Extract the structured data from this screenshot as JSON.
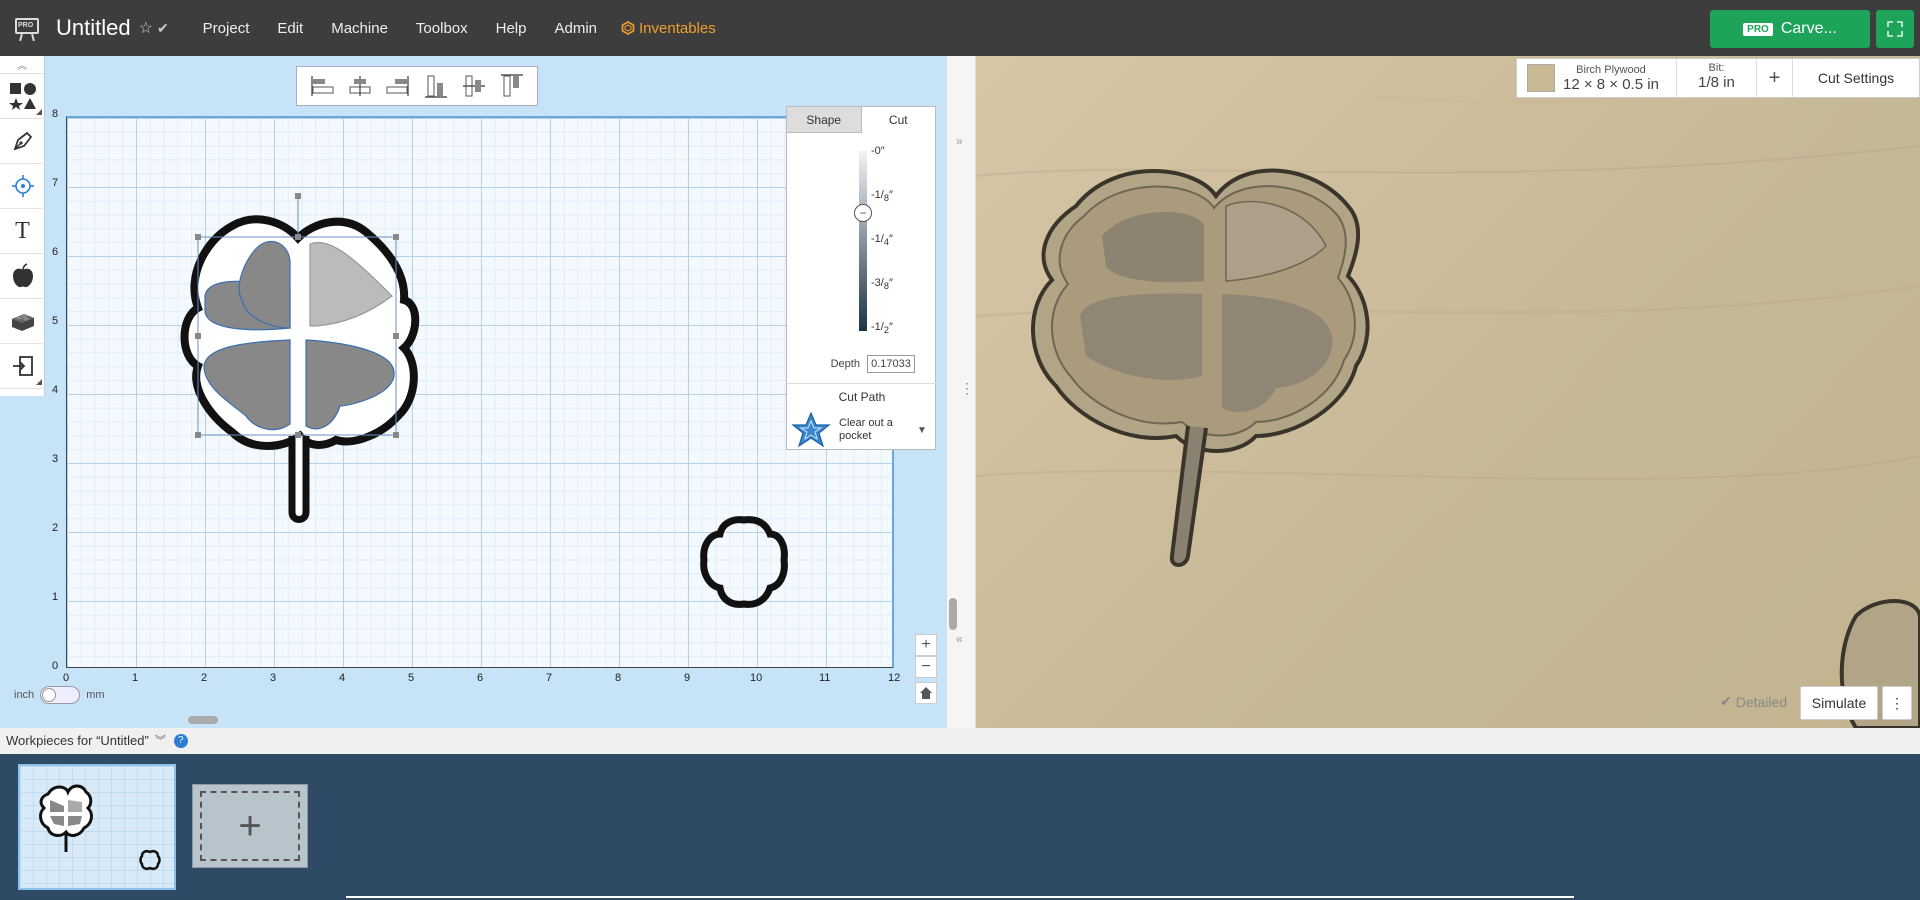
{
  "app": {
    "title": "Untitled",
    "menu": [
      "Project",
      "Edit",
      "Machine",
      "Toolbox",
      "Help",
      "Admin"
    ],
    "inventables_label": "Inventables",
    "logo_text": "PRO",
    "carve_button": {
      "badge": "PRO",
      "label": "Carve..."
    }
  },
  "toolbox": {
    "tools": [
      "shapes-icon",
      "pen-icon",
      "point-icon",
      "text-icon",
      "apple-icon",
      "lego-brick-icon",
      "import-icon"
    ],
    "text_tool_glyph": "T"
  },
  "canvas": {
    "y_ticks": [
      "8",
      "7",
      "6",
      "5",
      "4",
      "3",
      "2",
      "1",
      "0"
    ],
    "x_ticks": [
      "0",
      "1",
      "2",
      "3",
      "4",
      "5",
      "6",
      "7",
      "8",
      "9",
      "10",
      "11",
      "12"
    ],
    "units": {
      "left": "inch",
      "right": "mm"
    }
  },
  "cut_panel": {
    "tabs": [
      "Shape",
      "Cut"
    ],
    "active_tab": "Cut",
    "depth_labels": [
      {
        "num": "-0",
        "den": ""
      },
      {
        "num": "-1",
        "den": "8"
      },
      {
        "num": "-1",
        "den": "4"
      },
      {
        "num": "-3",
        "den": "8"
      },
      {
        "num": "-1",
        "den": "2"
      }
    ],
    "depth_label": "Depth",
    "depth_value": "0.17033",
    "cut_path_title": "Cut Path",
    "cut_path_type": "Clear out a pocket"
  },
  "preview": {
    "material_name": "Birch Plywood",
    "material_size": "12 × 8 × 0.5 in",
    "bit_label": "Bit:",
    "bit_value": "1/8 in",
    "add_label": "+",
    "cut_settings_label": "Cut Settings",
    "detailed_label": "Detailed",
    "simulate_label": "Simulate",
    "more_label": "⋮"
  },
  "workpieces": {
    "header": "Workpieces for “Untitled”",
    "help": "?",
    "add_label": "+"
  },
  "colors": {
    "topbar": "#3d3d3d",
    "carve_green": "#1ea45a",
    "canvas_blue": "#c6e3f8",
    "inventables_orange": "#f0a030",
    "tray": "#2e4a64"
  }
}
